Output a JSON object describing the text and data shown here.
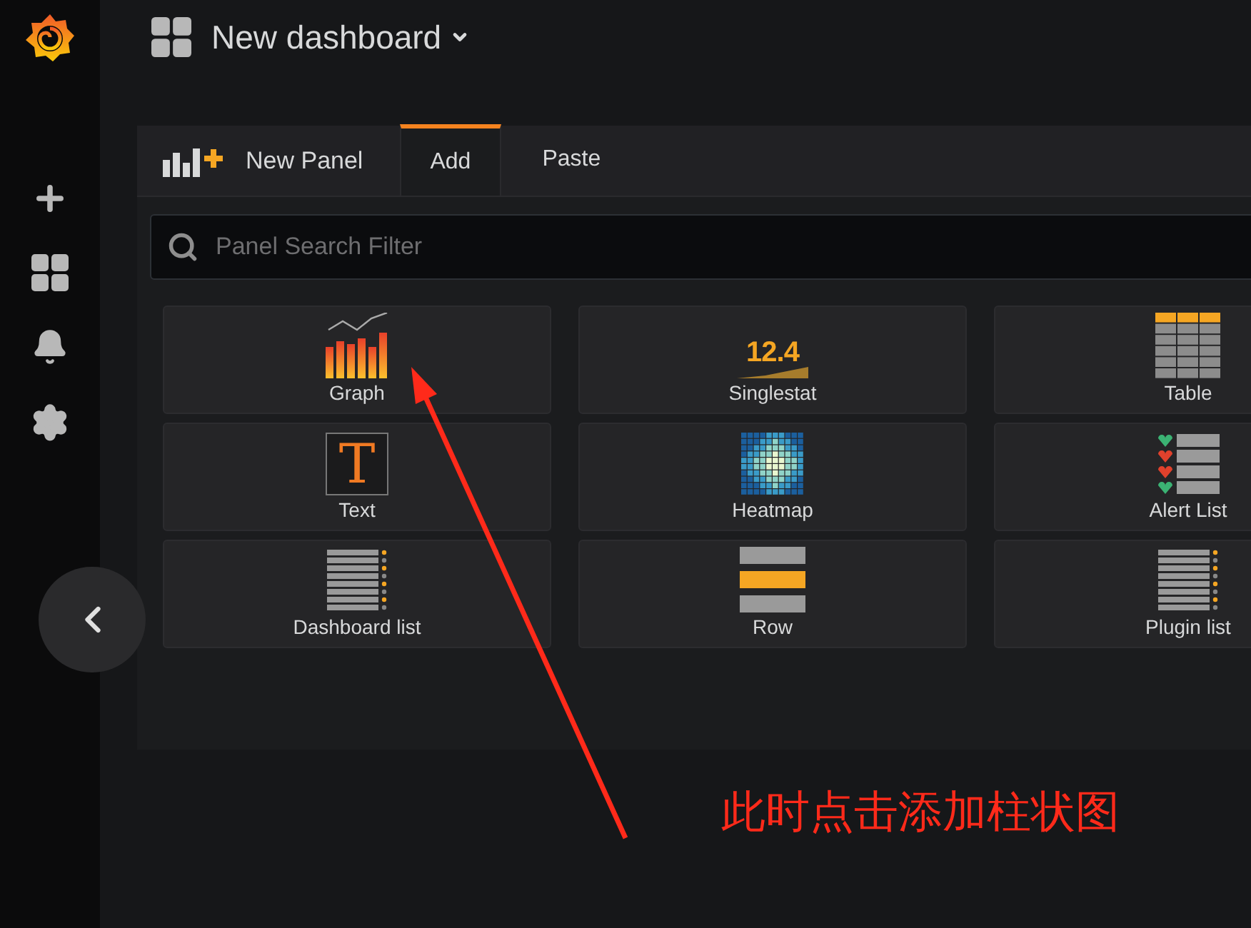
{
  "header": {
    "title": "New dashboard"
  },
  "panel_picker": {
    "title": "New Panel",
    "tabs": [
      {
        "label": "Add",
        "selected": true
      },
      {
        "label": "Paste",
        "selected": false
      }
    ],
    "search": {
      "placeholder": "Panel Search Filter"
    },
    "panels": [
      {
        "kind": "graph",
        "label": "Graph"
      },
      {
        "kind": "singlestat",
        "label": "Singlestat",
        "icon_text": "12.4"
      },
      {
        "kind": "table",
        "label": "Table"
      },
      {
        "kind": "text",
        "label": "Text",
        "icon_text": "T"
      },
      {
        "kind": "heatmap",
        "label": "Heatmap"
      },
      {
        "kind": "alertlist",
        "label": "Alert List"
      },
      {
        "kind": "dashlist",
        "label": "Dashboard list"
      },
      {
        "kind": "row",
        "label": "Row"
      },
      {
        "kind": "pluginlist",
        "label": "Plugin list"
      }
    ]
  },
  "annotation": {
    "text": "此时点击添加柱状图"
  }
}
